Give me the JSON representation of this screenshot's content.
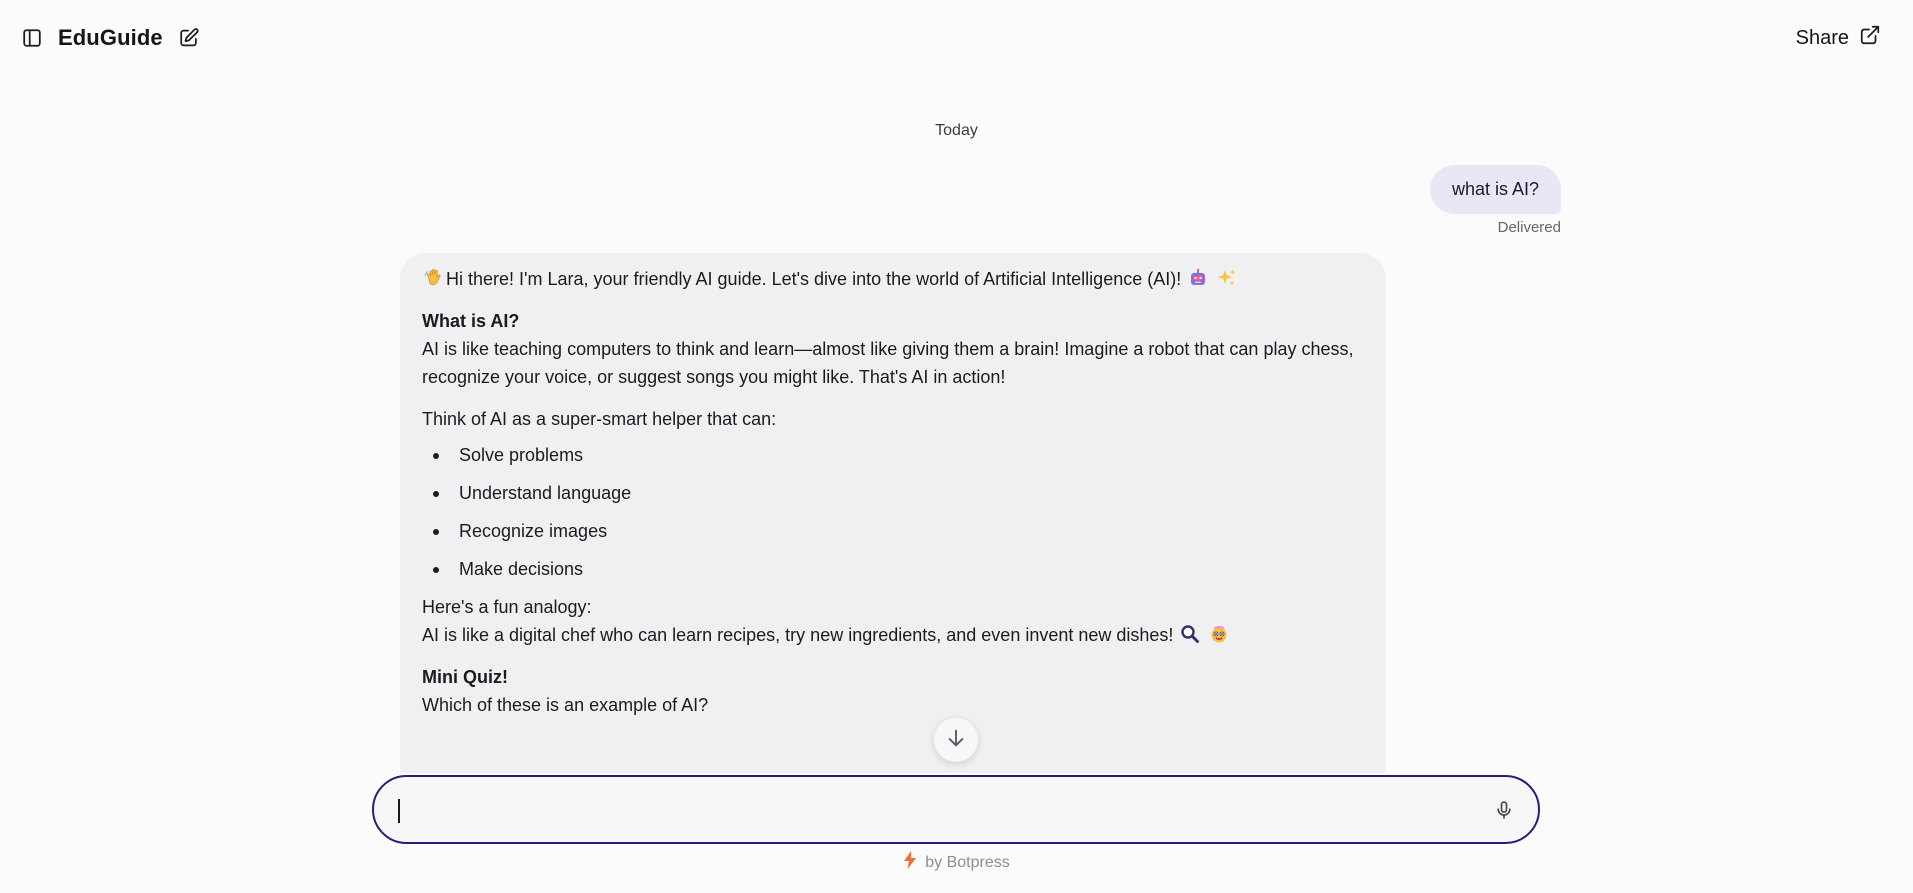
{
  "header": {
    "title": "EduGuide",
    "share_label": "Share",
    "sidebar_icon": "sidebar-toggle-icon",
    "edit_icon": "new-chat-edit-icon",
    "share_icon": "external-link-icon"
  },
  "conversation": {
    "date_separator": "Today",
    "user_message": {
      "text": "what is AI?",
      "status": "Delivered"
    },
    "bot_message": {
      "greeting": "Hi there! I'm Lara, your friendly AI guide. Let's dive into the world of Artificial Intelligence (AI)!",
      "section1_heading": "What is AI?",
      "section1_body": "AI is like teaching computers to think and learn—almost like giving them a brain! Imagine a robot that can play chess, recognize your voice, or suggest songs you might like. That's AI in action!",
      "section2_intro": "Think of AI as a super-smart helper that can:",
      "abilities": [
        "Solve problems",
        "Understand language",
        "Recognize images",
        "Make decisions"
      ],
      "analogy_intro": "Here's a fun analogy:",
      "analogy_body": "AI is like a digital chef who can learn recipes, try new ingredients, and even invent new dishes!",
      "quiz_heading": "Mini Quiz!",
      "quiz_question": "Which of these is an example of AI?"
    }
  },
  "composer": {
    "value": "",
    "placeholder": "",
    "mic_icon": "microphone-icon"
  },
  "footer": {
    "text": "by Botpress",
    "icon": "lightning-bolt-icon"
  },
  "colors": {
    "accent_border": "#2a1a7a",
    "user_bubble": "#ebe6f6",
    "bot_bubble": "#f0f0f3",
    "bolt": "#f26b3a"
  }
}
